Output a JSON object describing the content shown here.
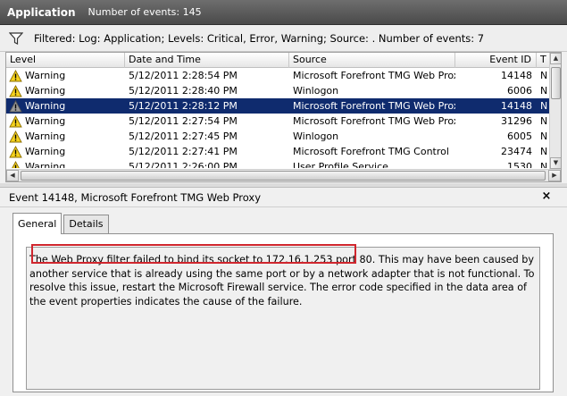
{
  "titlebar": {
    "app_name": "Application",
    "event_count": "Number of events: 145"
  },
  "filter": {
    "icon": "funnel-icon",
    "text": "Filtered: Log: Application; Levels: Critical, Error, Warning; Source: . Number of events: 7"
  },
  "grid": {
    "columns": [
      "Level",
      "Date and Time",
      "Source",
      "Event ID",
      "T"
    ],
    "rows": [
      {
        "level": "Warning",
        "date": "5/12/2011 2:28:54 PM",
        "source": "Microsoft Forefront TMG Web Proxy",
        "id": "14148",
        "task": "N"
      },
      {
        "level": "Warning",
        "date": "5/12/2011 2:28:40 PM",
        "source": "Winlogon",
        "id": "6006",
        "task": "N"
      },
      {
        "level": "Warning",
        "date": "5/12/2011 2:28:12 PM",
        "source": "Microsoft Forefront TMG Web Proxy",
        "id": "14148",
        "task": "N"
      },
      {
        "level": "Warning",
        "date": "5/12/2011 2:27:54 PM",
        "source": "Microsoft Forefront TMG Web Proxy",
        "id": "31296",
        "task": "N"
      },
      {
        "level": "Warning",
        "date": "5/12/2011 2:27:45 PM",
        "source": "Winlogon",
        "id": "6005",
        "task": "N"
      },
      {
        "level": "Warning",
        "date": "5/12/2011 2:27:41 PM",
        "source": "Microsoft Forefront TMG Control",
        "id": "23474",
        "task": "N"
      },
      {
        "level": "Warning",
        "date": "5/12/2011 2:26:00 PM",
        "source": "User Profile Service",
        "id": "1530",
        "task": "N"
      }
    ],
    "selected_index": 2
  },
  "detail": {
    "title": "Event 14148, Microsoft Forefront TMG Web Proxy",
    "close_label": "×",
    "tabs": [
      "General",
      "Details"
    ],
    "active_tab": "General",
    "description": "The Web Proxy filter failed to bind its socket to 172.16.1.253 port 80. This may have been caused by another service that is already using the same port or by a network adapter that is not functional. To resolve this issue, restart the Microsoft Firewall service. The error code specified in the data area of the event properties indicates the cause of the failure."
  },
  "colors": {
    "selection": "#0f2b6e",
    "warning_yellow": "#f5d21e",
    "highlight_red": "#d0262e"
  }
}
